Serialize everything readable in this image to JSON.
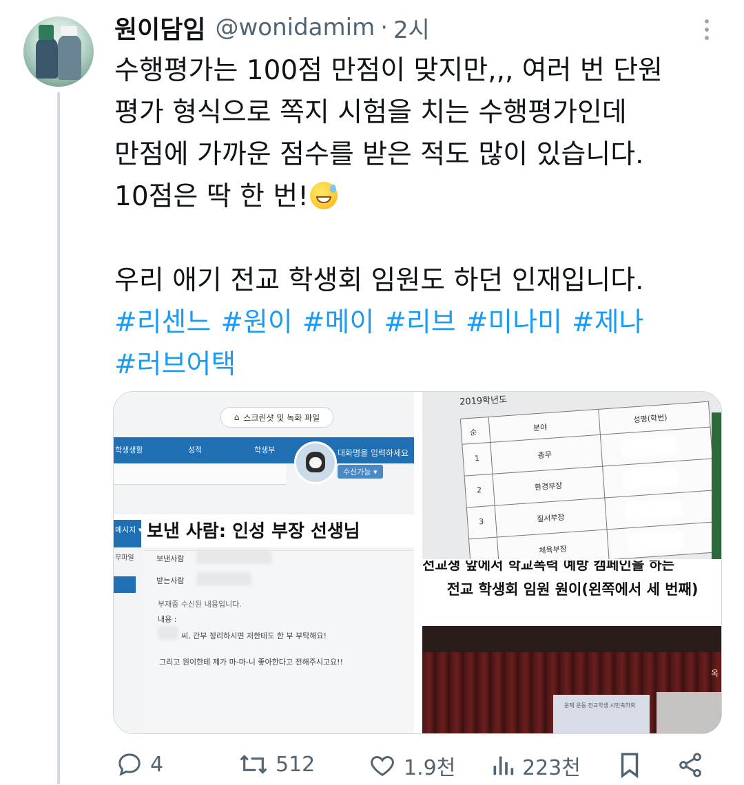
{
  "tweet": {
    "display_name": "원이담임",
    "handle": "@wonidamim",
    "separator": "·",
    "time": "2시",
    "lines": [
      "수행평가는 100점 만점이 맞지만,,, 여러 번 단원",
      "평가 형식으로 쪽지 시험을 치는 수행평가인데",
      "만점에 가까운 점수를 받은 적도 많이 있습니다.",
      "10점은 딱 한 번!",
      "우리 애기 전교 학생회 임원도 하던 인재입니다."
    ],
    "emoji_name": "grinning-face-with-sweat",
    "hashtags": [
      "#리센느",
      "#원이",
      "#메이",
      "#리브",
      "#미나미",
      "#제나"
    ],
    "hashtags_line2": [
      "#러브어택"
    ]
  },
  "media": {
    "left": {
      "chip_label": "스크린샷 및 녹화 파일",
      "tabs": [
        "학생생활",
        "성적",
        "학생부"
      ],
      "name_placeholder": "대화명을 입력하세요",
      "status": "수신가능 ▾",
      "side_label": "메시지 ▾",
      "side_label2": "무파일",
      "sender_overlay": "보낸 사람: 인성 부장 선생님",
      "from_label": "보낸사람",
      "to_label": "받는사람",
      "absence_note": "부재중 수신된 내용입니다.",
      "content_label": "내용 :",
      "message_line1": "씨, 간부 정리하시면 저한테도 한 부 부탁해요!",
      "message_line2": "그리고 원이한테 제가 마-마-니 좋아한다고 전해주시고요!!"
    },
    "top_right": {
      "header_text": "2019학년도",
      "col_headers": [
        "순",
        "분야",
        "성명(학번)"
      ],
      "rows": [
        {
          "num": "1",
          "dept": "총무"
        },
        {
          "num": "2",
          "dept": "환경부장"
        },
        {
          "num": "3",
          "dept": "질서부장"
        },
        {
          "num": "",
          "dept": "체육부장"
        }
      ]
    },
    "bottom_right": {
      "cut_caption": "전교생 앞에서 학교폭력 예방 캠페인을 하는",
      "caption": "전교 학생회 임원 원이(왼쪽에서 세 번째)",
      "stage_label": "옥",
      "screen_text": "운제 운동 전교학생 시민축하회"
    }
  },
  "actions": {
    "replies": "4",
    "retweets": "512",
    "likes": "1.9천",
    "views": "223천"
  },
  "colors": {
    "text": "#0f1419",
    "secondary": "#536471",
    "link": "#1d9bf0",
    "thread_line": "#cfd9de"
  }
}
